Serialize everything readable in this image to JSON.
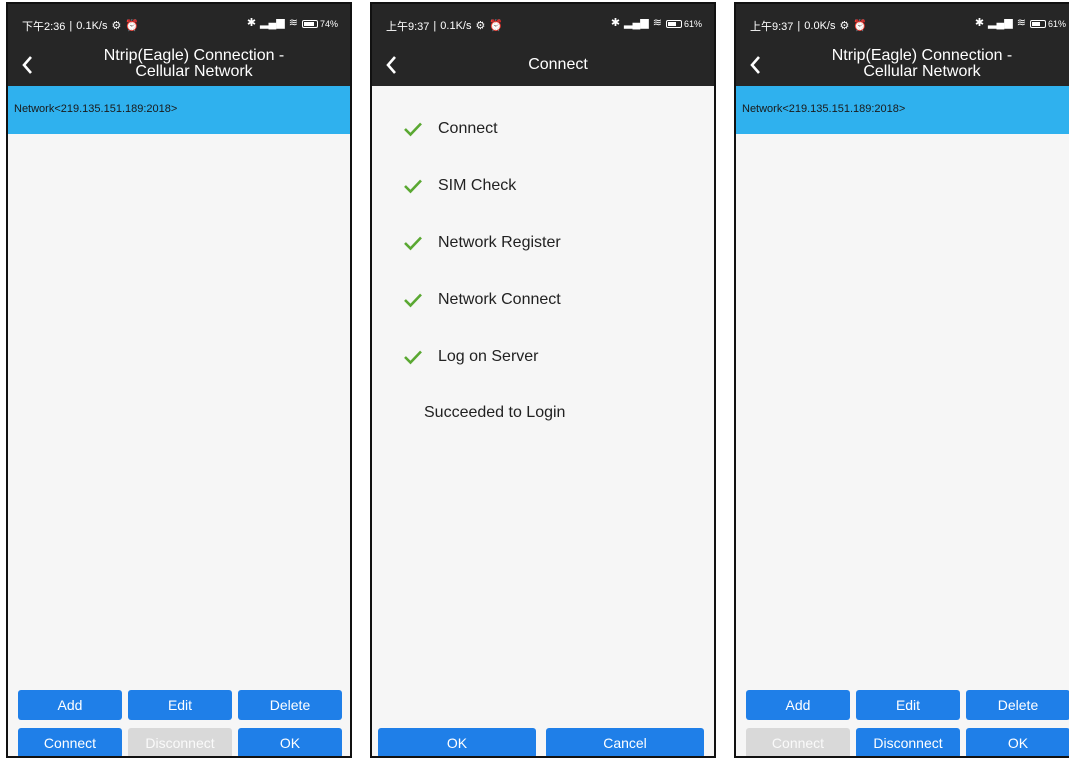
{
  "screens": [
    {
      "status": {
        "time": "下午2:36",
        "speed": "0.1K/s",
        "battery": "74"
      },
      "title_line1": "Ntrip(Eagle) Connection -",
      "title_line2": "Cellular Network",
      "network_item": "Network<219.135.151.189:2018>",
      "buttons": {
        "add": "Add",
        "edit": "Edit",
        "delete": "Delete",
        "connect": "Connect",
        "disconnect": "Disconnect",
        "ok": "OK"
      }
    },
    {
      "status": {
        "time": "上午9:37",
        "speed": "0.1K/s",
        "battery": "61"
      },
      "title": "Connect",
      "steps": [
        "Connect",
        "SIM Check",
        "Network Register",
        "Network Connect",
        "Log on Server"
      ],
      "result": "Succeeded to Login",
      "buttons": {
        "ok": "OK",
        "cancel": "Cancel"
      }
    },
    {
      "status": {
        "time": "上午9:37",
        "speed": "0.0K/s",
        "battery": "61"
      },
      "title_line1": "Ntrip(Eagle) Connection -",
      "title_line2": "Cellular Network",
      "network_item": "Network<219.135.151.189:2018>",
      "buttons": {
        "add": "Add",
        "edit": "Edit",
        "delete": "Delete",
        "connect": "Connect",
        "disconnect": "Disconnect",
        "ok": "OK"
      }
    }
  ],
  "colors": {
    "accent": "#1f7fe8",
    "selection": "#2fb1ee",
    "disabled": "#d9d9d9",
    "check": "#5aa832",
    "header": "#262626"
  }
}
